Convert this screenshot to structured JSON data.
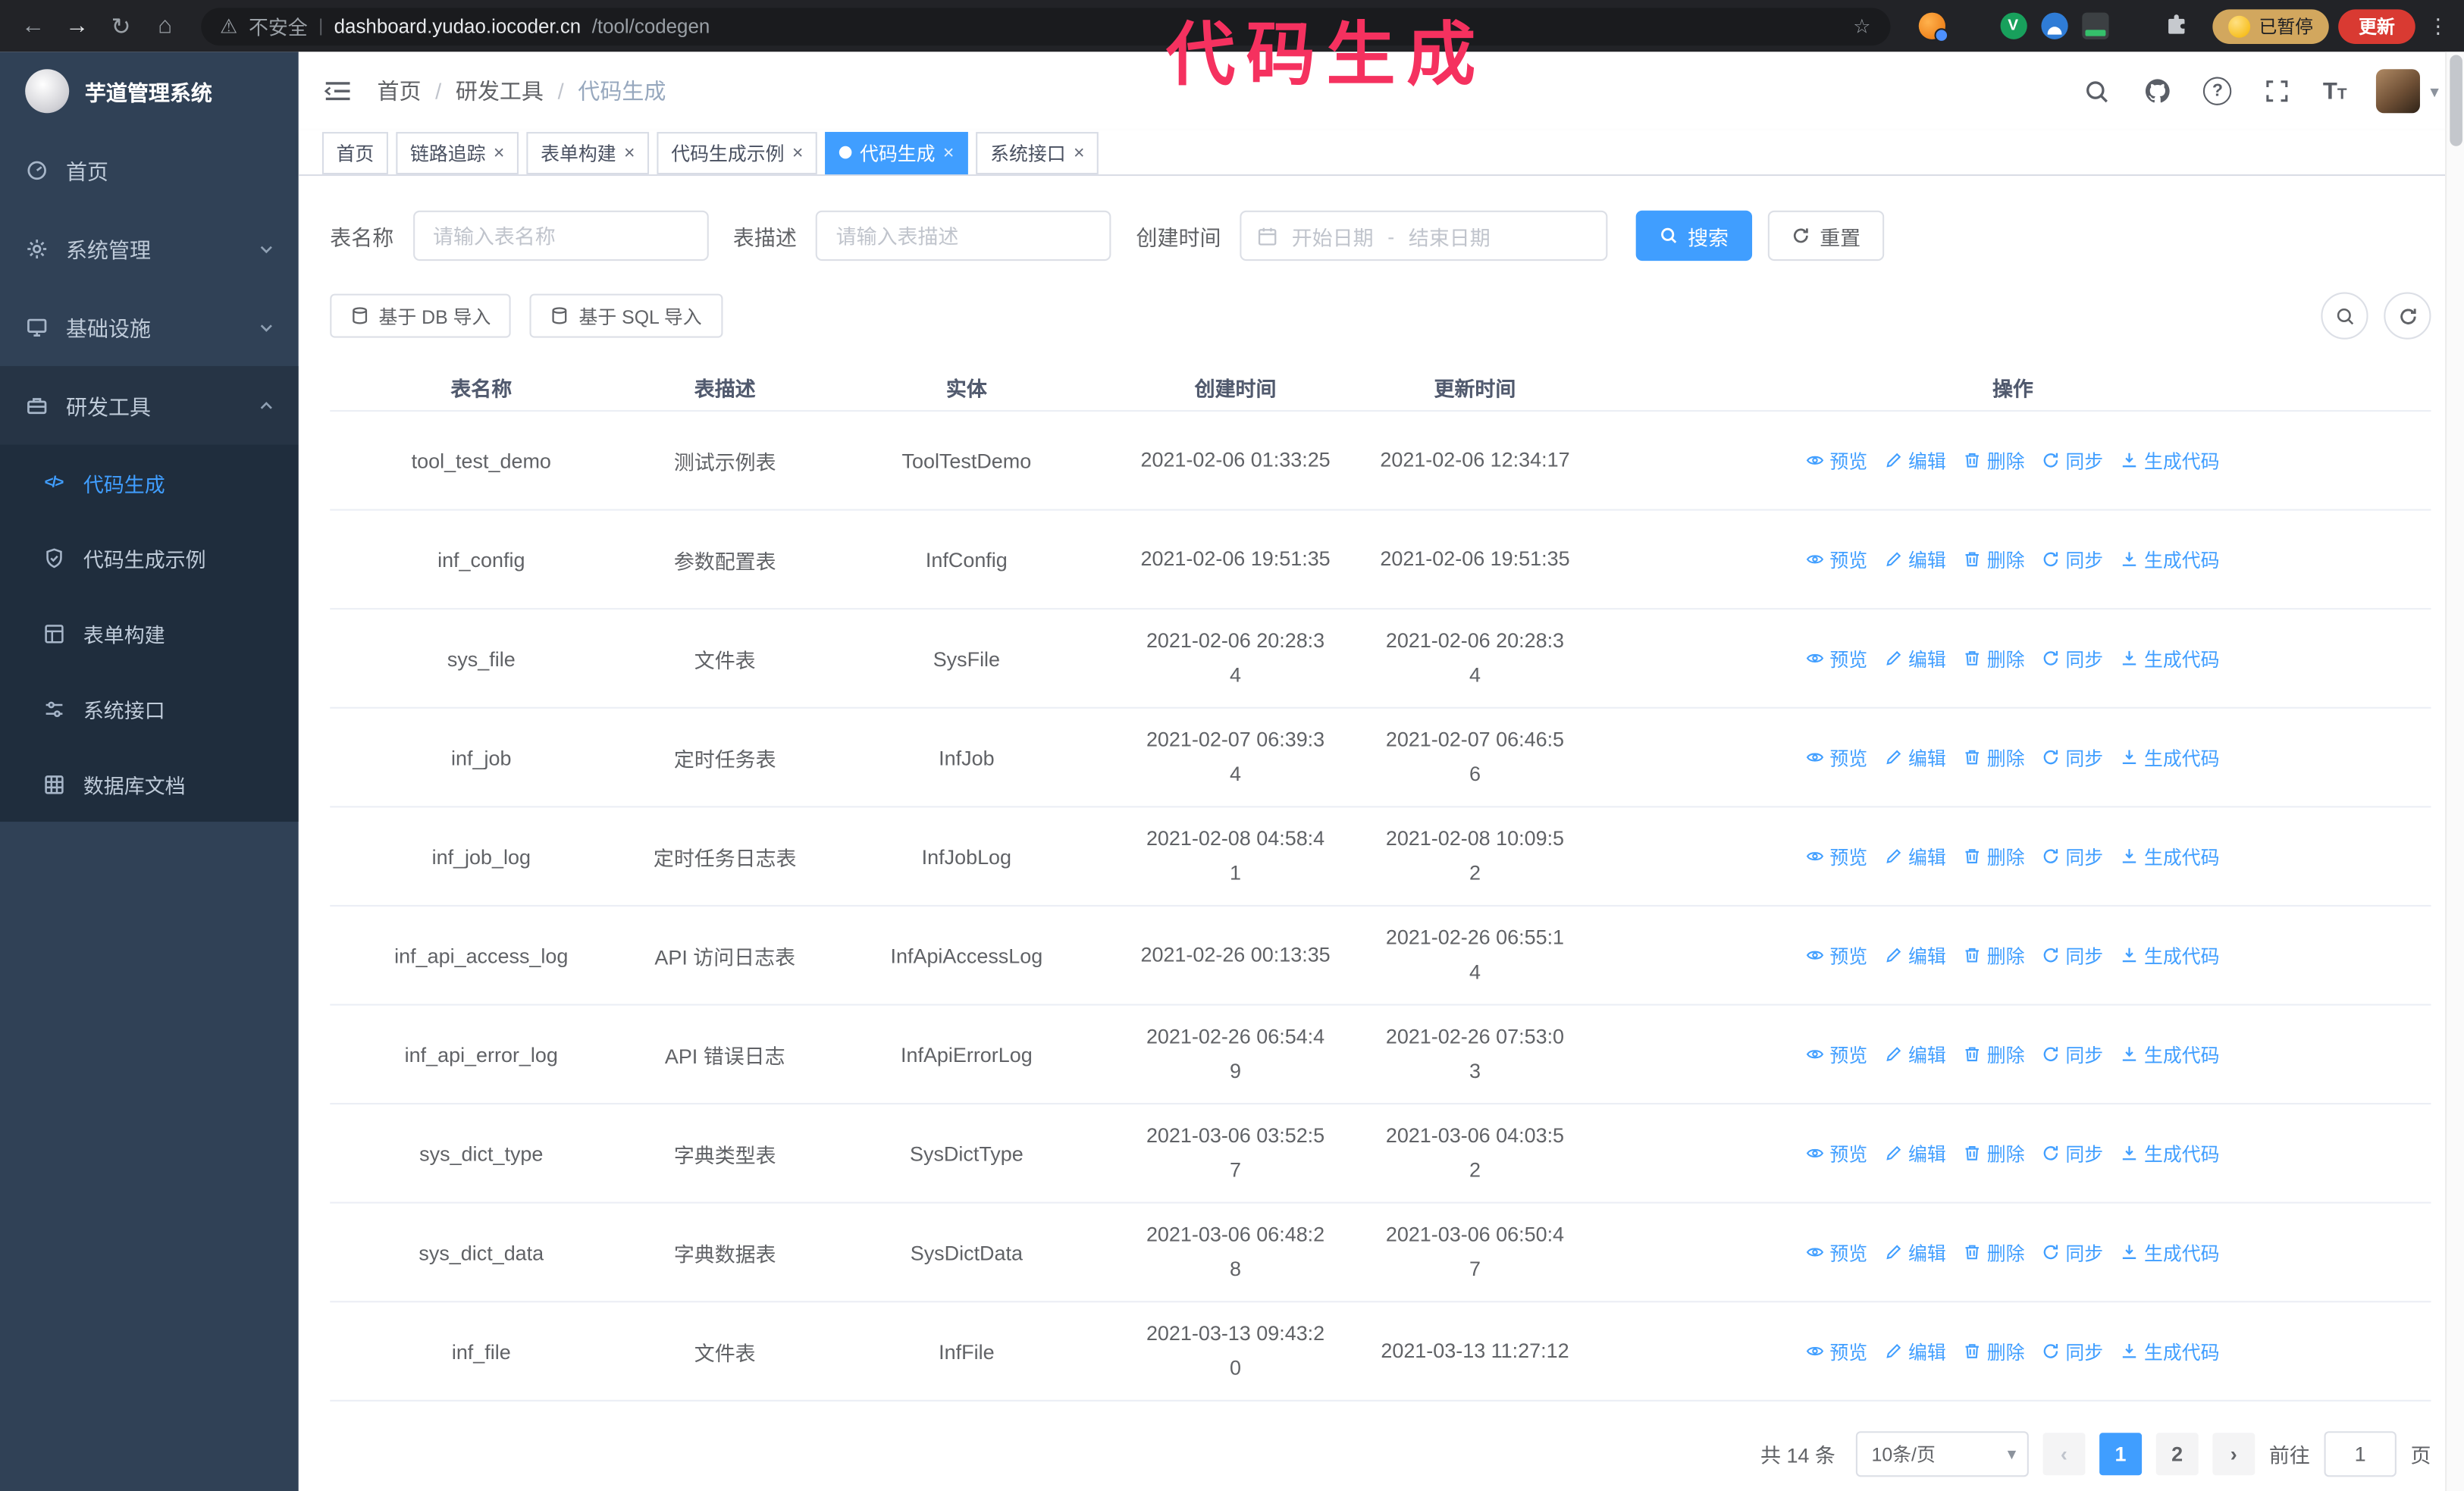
{
  "browser": {
    "insecure_label": "不安全",
    "url_host": "dashboard.yudao.iocoder.cn",
    "url_path": "/tool/codegen",
    "paused_badge": "已暂停",
    "update_button": "更新",
    "ext3_letter": "V"
  },
  "annotation": {
    "text": "代码生成",
    "color": "#f5315f"
  },
  "colors": {
    "accent": "#409EFF",
    "sidebar_bg": "#304156",
    "submenu_bg": "#1f2d3d",
    "update_chip": "#d93a32"
  },
  "sidebar": {
    "logo_title": "芋道管理系统",
    "items": [
      {
        "label": "首页"
      },
      {
        "label": "系统管理"
      },
      {
        "label": "基础设施"
      },
      {
        "label": "研发工具"
      }
    ],
    "submenu": [
      {
        "label": "代码生成"
      },
      {
        "label": "代码生成示例"
      },
      {
        "label": "表单构建"
      },
      {
        "label": "系统接口"
      },
      {
        "label": "数据库文档"
      }
    ]
  },
  "header": {
    "breadcrumb": [
      "首页",
      "研发工具",
      "代码生成"
    ],
    "breadcrumb_separator": "/"
  },
  "tabs": [
    {
      "label": "首页"
    },
    {
      "label": "链路追踪"
    },
    {
      "label": "表单构建"
    },
    {
      "label": "代码生成示例"
    },
    {
      "label": "代码生成"
    },
    {
      "label": "系统接口"
    }
  ],
  "filters": {
    "table_name_label": "表名称",
    "table_name_placeholder": "请输入表名称",
    "table_desc_label": "表描述",
    "table_desc_placeholder": "请输入表描述",
    "create_time_label": "创建时间",
    "start_placeholder": "开始日期",
    "range_separator": "-",
    "end_placeholder": "结束日期",
    "search_label": "搜索",
    "reset_label": "重置"
  },
  "toolbar": {
    "import_db_label": "基于 DB 导入",
    "import_sql_label": "基于 SQL 导入"
  },
  "table": {
    "columns": [
      "表名称",
      "表描述",
      "实体",
      "创建时间",
      "更新时间",
      "操作"
    ],
    "actions": [
      "预览",
      "编辑",
      "删除",
      "同步",
      "生成代码"
    ],
    "rows": [
      {
        "name": "tool_test_demo",
        "desc": "测试示例表",
        "entity": "ToolTestDemo",
        "created": "2021-02-06 01:33:25",
        "updated": "2021-02-06 12:34:17"
      },
      {
        "name": "inf_config",
        "desc": "参数配置表",
        "entity": "InfConfig",
        "created": "2021-02-06 19:51:35",
        "updated": "2021-02-06 19:51:35"
      },
      {
        "name": "sys_file",
        "desc": "文件表",
        "entity": "SysFile",
        "created": "2021-02-06 20:28:3\n4",
        "updated": "2021-02-06 20:28:3\n4"
      },
      {
        "name": "inf_job",
        "desc": "定时任务表",
        "entity": "InfJob",
        "created": "2021-02-07 06:39:3\n4",
        "updated": "2021-02-07 06:46:5\n6"
      },
      {
        "name": "inf_job_log",
        "desc": "定时任务日志表",
        "entity": "InfJobLog",
        "created": "2021-02-08 04:58:4\n1",
        "updated": "2021-02-08 10:09:5\n2"
      },
      {
        "name": "inf_api_access_log",
        "desc": "API 访问日志表",
        "entity": "InfApiAccessLog",
        "created": "2021-02-26 00:13:35",
        "updated": "2021-02-26 06:55:1\n4"
      },
      {
        "name": "inf_api_error_log",
        "desc": "API 错误日志",
        "entity": "InfApiErrorLog",
        "created": "2021-02-26 06:54:4\n9",
        "updated": "2021-02-26 07:53:0\n3"
      },
      {
        "name": "sys_dict_type",
        "desc": "字典类型表",
        "entity": "SysDictType",
        "created": "2021-03-06 03:52:5\n7",
        "updated": "2021-03-06 04:03:5\n2"
      },
      {
        "name": "sys_dict_data",
        "desc": "字典数据表",
        "entity": "SysDictData",
        "created": "2021-03-06 06:48:2\n8",
        "updated": "2021-03-06 06:50:4\n7"
      },
      {
        "name": "inf_file",
        "desc": "文件表",
        "entity": "InfFile",
        "created": "2021-03-13 09:43:2\n0",
        "updated": "2021-03-13 11:27:12"
      }
    ]
  },
  "pagination": {
    "total": "共 14 条",
    "page_size": "10条/页",
    "pages": [
      "1",
      "2"
    ],
    "goto_label": "前往",
    "goto_value": "1",
    "unit_label": "页"
  },
  "icons": {
    "back": "←",
    "forward": "→",
    "reload": "↻",
    "home": "⌂",
    "warning": "⚠",
    "divider": "|",
    "star": "☆",
    "kebab": "⋮",
    "puzzle": "⬡",
    "caret_down": "▾",
    "close": "×",
    "prev": "‹",
    "next": "›",
    "code": "</>"
  }
}
